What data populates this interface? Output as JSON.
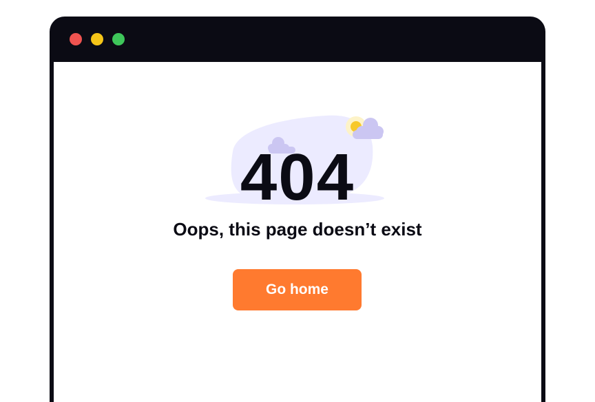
{
  "window": {
    "controls": [
      {
        "name": "close",
        "color": "#ef5350"
      },
      {
        "name": "minimize",
        "color": "#f5c518"
      },
      {
        "name": "maximize",
        "color": "#3ec65a"
      }
    ]
  },
  "error": {
    "code": "404",
    "message": "Oops, this page doesn’t exist"
  },
  "actions": {
    "go_home_label": "Go home"
  },
  "colors": {
    "frame": "#0b0b14",
    "accent": "#ff7a2f",
    "blob": "#ecebff",
    "cloud": "#cbc6f2",
    "sun": "#f7c82a"
  },
  "icons": [
    "cloud-icon",
    "sun-icon"
  ]
}
